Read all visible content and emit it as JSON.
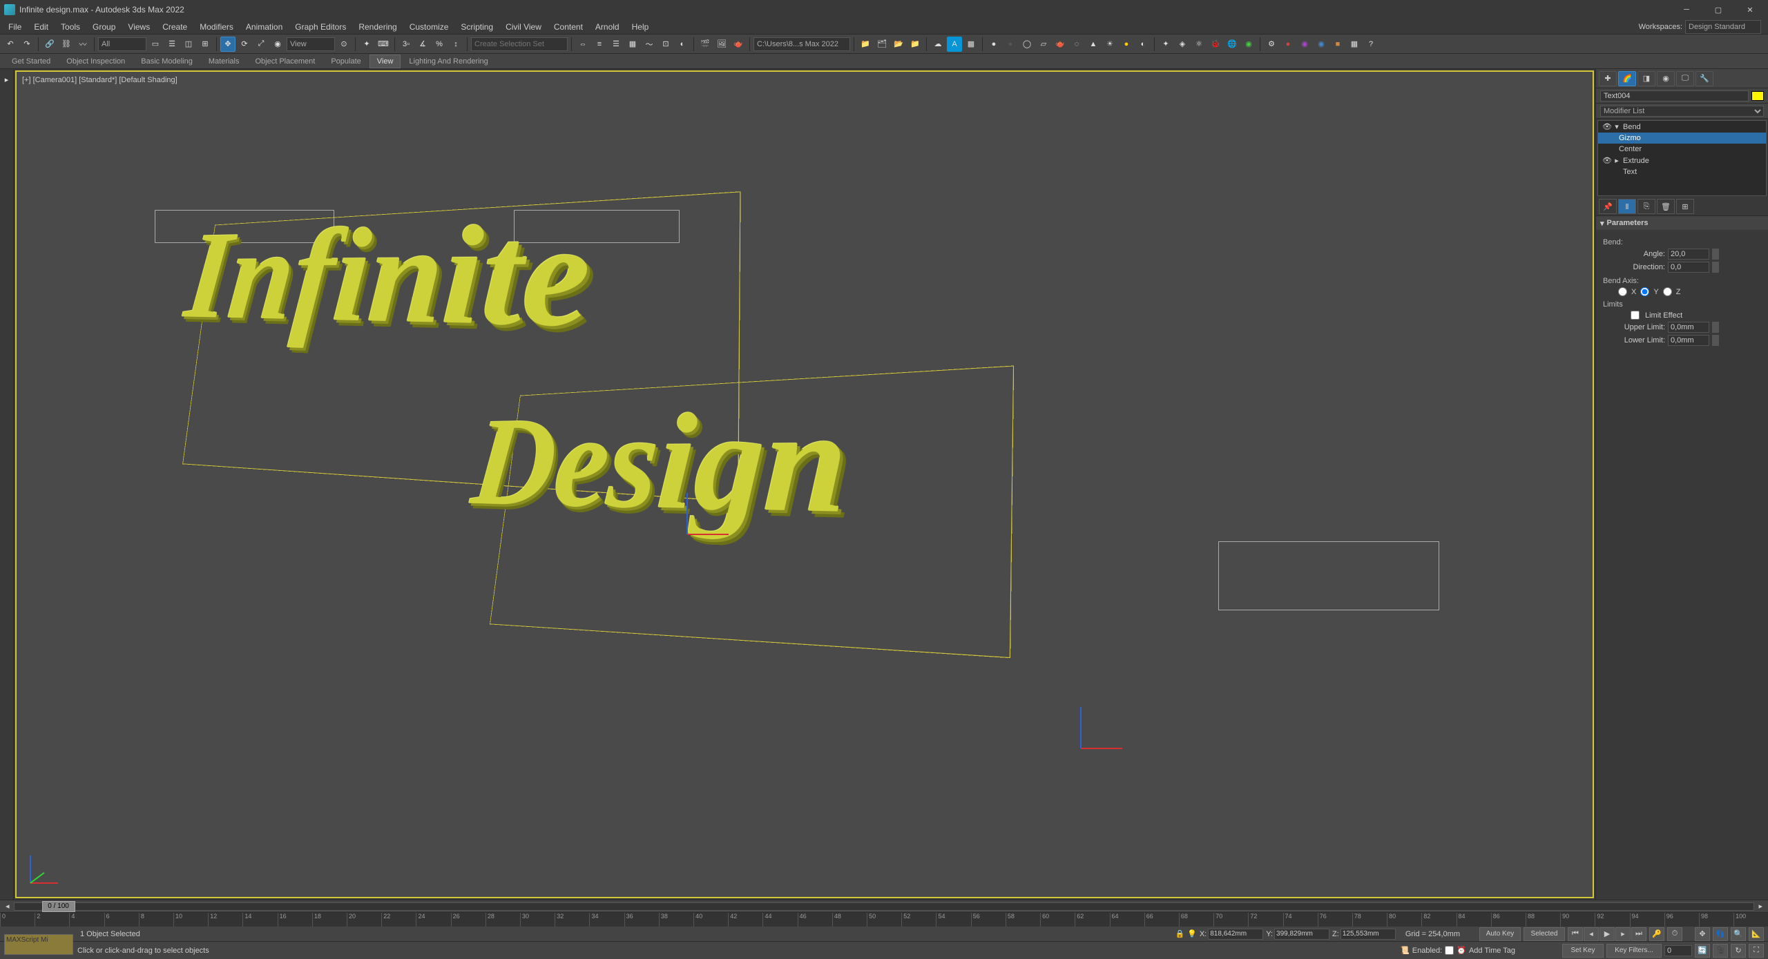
{
  "title": "Infinite design.max - Autodesk 3ds Max 2022",
  "menu": [
    "File",
    "Edit",
    "Tools",
    "Group",
    "Views",
    "Create",
    "Modifiers",
    "Animation",
    "Graph Editors",
    "Rendering",
    "Customize",
    "Scripting",
    "Civil View",
    "Content",
    "Arnold",
    "Help"
  ],
  "workspace_label": "Workspaces:",
  "workspace_value": "Design Standard",
  "toolbar_all": "All",
  "toolbar_view": "View",
  "toolbar_selset": "Create Selection Set",
  "toolbar_path": "C:\\Users\\8...s Max 2022",
  "ribbon_tabs": [
    "Get Started",
    "Object Inspection",
    "Basic Modeling",
    "Materials",
    "Object Placement",
    "Populate",
    "View",
    "Lighting And Rendering"
  ],
  "ribbon_active": 6,
  "viewport_label": "[+] [Camera001] [Standard*] [Default Shading]",
  "text1": "Infinite",
  "text2": "Design",
  "object_name": "Text004",
  "mod_list_label": "Modifier List",
  "stack": {
    "bend": "Bend",
    "gizmo": "Gizmo",
    "center": "Center",
    "extrude": "Extrude",
    "text": "Text"
  },
  "rollout_title": "Parameters",
  "bend_group": "Bend:",
  "angle_label": "Angle:",
  "angle_val": "20,0",
  "dir_label": "Direction:",
  "dir_val": "0,0",
  "axis_group": "Bend Axis:",
  "axis_x": "X",
  "axis_y": "Y",
  "axis_z": "Z",
  "limits_group": "Limits",
  "limit_check": "Limit Effect",
  "upper_label": "Upper Limit:",
  "upper_val": "0,0mm",
  "lower_label": "Lower Limit:",
  "lower_val": "0,0mm",
  "timeslider": "0 / 100",
  "ticks": [
    "0",
    "2",
    "4",
    "6",
    "8",
    "10",
    "12",
    "14",
    "16",
    "18",
    "20",
    "22",
    "24",
    "26",
    "28",
    "30",
    "32",
    "34",
    "36",
    "38",
    "40",
    "42",
    "44",
    "46",
    "48",
    "50",
    "52",
    "54",
    "56",
    "58",
    "60",
    "62",
    "64",
    "66",
    "68",
    "70",
    "72",
    "74",
    "76",
    "78",
    "80",
    "82",
    "84",
    "86",
    "88",
    "90",
    "92",
    "94",
    "96",
    "98",
    "100"
  ],
  "status_selected": "1 Object Selected",
  "status_prompt": "Click or click-and-drag to select objects",
  "maxscript": "MAXScript Mi",
  "coord_x_lbl": "X:",
  "coord_x": "818,642mm",
  "coord_y_lbl": "Y:",
  "coord_y": "399,829mm",
  "coord_z_lbl": "Z:",
  "coord_z": "125,553mm",
  "grid": "Grid = 254,0mm",
  "enabled": "Enabled:",
  "addtime": "Add Time Tag",
  "autokey": "Auto Key",
  "setkey": "Set Key",
  "selected_lbl": "Selected",
  "keyfilters": "Key Filters..."
}
